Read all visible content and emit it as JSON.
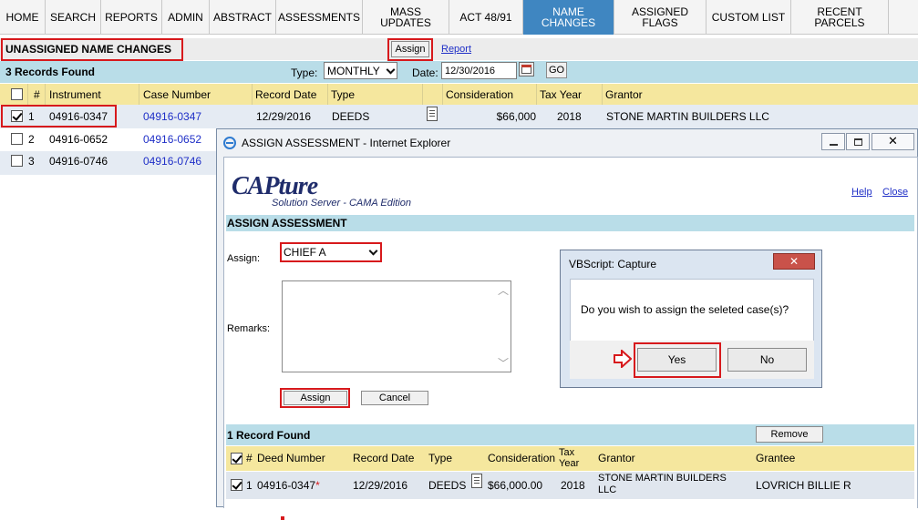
{
  "nav": {
    "items": [
      {
        "label": "HOME"
      },
      {
        "label": "SEARCH"
      },
      {
        "label": "REPORTS"
      },
      {
        "label": "ADMIN"
      },
      {
        "label": "ABSTRACT"
      },
      {
        "label": "ASSESSMENTS"
      },
      {
        "label": "MASS\nUPDATES"
      },
      {
        "label": "ACT 48/91"
      },
      {
        "label": "NAME\nCHANGES"
      },
      {
        "label": "ASSIGNED\nFLAGS"
      },
      {
        "label": "CUSTOM LIST"
      },
      {
        "label": "RECENT\nPARCELS"
      }
    ],
    "active": "NAME CHANGES"
  },
  "page": {
    "title": "UNASSIGNED NAME CHANGES",
    "assign_label": "Assign",
    "report_label": "Report"
  },
  "filters": {
    "records_found": "3 Records Found",
    "type_label": "Type:",
    "type_value": "MONTHLY",
    "date_label": "Date:",
    "date_value": "12/30/2016",
    "go_label": "GO"
  },
  "table": {
    "headers": [
      "#",
      "Instrument",
      "Case Number",
      "Record Date",
      "Type",
      "Consideration",
      "Tax Year",
      "Grantor"
    ],
    "rows": [
      {
        "num": "1",
        "instrument": "04916-0347",
        "case": "04916-0347",
        "record_date": "12/29/2016",
        "type": "DEEDS",
        "consideration": "$66,000",
        "tax_year": "2018",
        "grantor": "STONE MARTIN BUILDERS LLC",
        "checked": true
      },
      {
        "num": "2",
        "instrument": "04916-0652",
        "case": "04916-0652",
        "checked": false
      },
      {
        "num": "3",
        "instrument": "04916-0746",
        "case": "04916-0746",
        "checked": false
      }
    ]
  },
  "ie_window": {
    "title": "ASSIGN ASSESSMENT - Internet Explorer",
    "logo_main": "CAPture",
    "logo_sub": "Solution Server - CAMA Edition",
    "help_label": "Help",
    "close_label": "Close",
    "section_title": "ASSIGN ASSESSMENT",
    "assign_label": "Assign:",
    "assign_value": "CHIEF A",
    "remarks_label": "Remarks:",
    "assign_button": "Assign",
    "cancel_button": "Cancel",
    "records_found": "1 Record Found",
    "remove_button": "Remove",
    "headers": [
      "#",
      "Deed Number",
      "Record Date",
      "Type",
      "Consideration",
      "Tax Year",
      "Grantor",
      "Grantee"
    ],
    "row": {
      "num": "1",
      "deed": "04916-0347",
      "required_mark": "*",
      "record_date": "12/29/2016",
      "type": "DEEDS",
      "consideration": "$66,000.00",
      "tax_year": "2018",
      "grantor": "STONE MARTIN BUILDERS LLC",
      "grantee": "LOVRICH BILLIE R"
    }
  },
  "message_box": {
    "title": "VBScript: Capture",
    "text": "Do you wish to assign the seleted case(s)?",
    "yes_label": "Yes",
    "no_label": "No"
  },
  "colors": {
    "accent_red": "#d7191c",
    "nav_active": "#3f86c1",
    "header_yellow": "#f5e79e",
    "filter_blue": "#b9dde8"
  }
}
